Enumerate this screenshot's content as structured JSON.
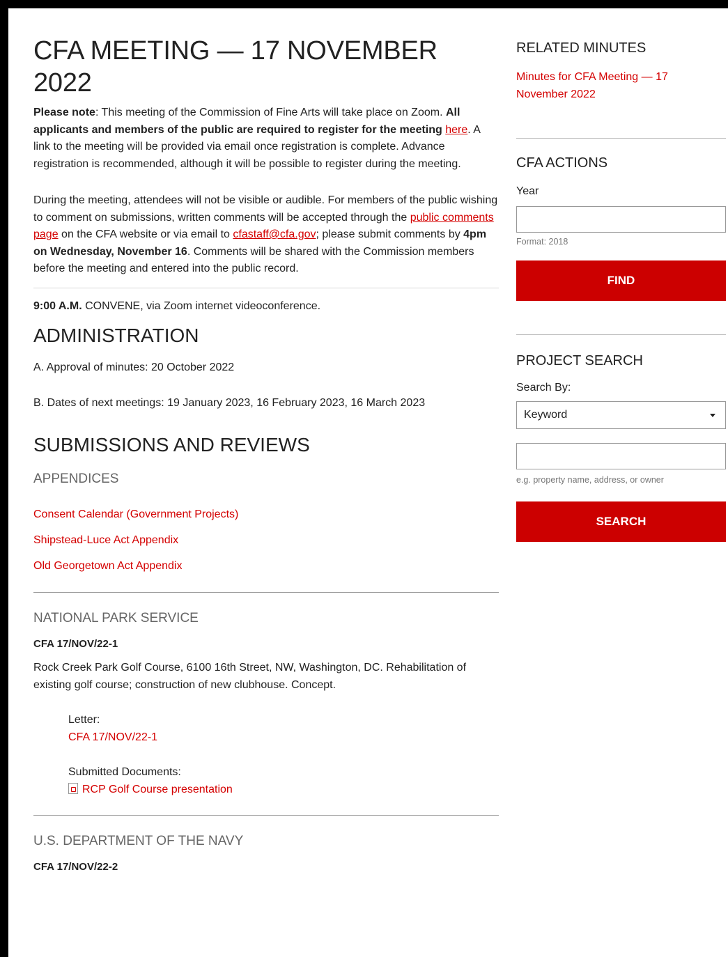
{
  "main": {
    "title": "CFA MEETING — 17 NOVEMBER 2022",
    "notice": {
      "please_note_label": "Please note",
      "text1": ": This meeting of the Commission of Fine Arts will take place on Zoom. ",
      "bold_required": "All applicants and members of the public are required to register for the meeting ",
      "here_link": "here",
      "text2": ". A link to the meeting will be provided via email once registration is complete. Advance registration is recommended, although it will be possible to register during the meeting."
    },
    "comments": {
      "text1": "During the meeting, attendees will not be visible or audible. For members of the public wishing to comment on submissions, written comments will be accepted through the ",
      "public_comments_link": "public comments page",
      "text2": " on the CFA website or via email to ",
      "email_link": "cfastaff@cfa.gov",
      "text3": "; please submit comments by ",
      "deadline_bold": "4pm on Wednesday, November 16",
      "text4": ". Comments will be shared with the Commission members before the meeting and entered into the public record."
    },
    "convene": {
      "time": "9:00 A.M.",
      "text": " CONVENE, via Zoom internet videoconference."
    },
    "administration": {
      "heading": "ADMINISTRATION",
      "item_a": "A. Approval of minutes: 20 October 2022",
      "item_b": "B. Dates of next meetings: 19 January 2023, 16 February 2023, 16 March 2023"
    },
    "submissions": {
      "heading": "SUBMISSIONS AND REVIEWS",
      "appendices_heading": "APPENDICES",
      "appendices": [
        "Consent Calendar (Government Projects)",
        "Shipstead-Luce Act Appendix",
        "Old Georgetown Act Appendix"
      ]
    },
    "nps": {
      "heading": "NATIONAL PARK SERVICE",
      "case": "CFA 17/NOV/22-1",
      "description": "Rock Creek Park Golf Course, 6100 16th Street, NW, Washington, DC. Rehabilitation of existing golf course; construction of new clubhouse. Concept.",
      "letter_label": "Letter:",
      "letter_link": "CFA 17/NOV/22-1",
      "docs_label": "Submitted Documents:",
      "doc_link": "RCP Golf Course presentation"
    },
    "navy": {
      "heading": "U.S. DEPARTMENT OF THE NAVY",
      "case": "CFA 17/NOV/22-2"
    }
  },
  "sidebar": {
    "related_heading": "RELATED MINUTES",
    "related_link": "Minutes for CFA Meeting — 17 November 2022",
    "actions_heading": "CFA ACTIONS",
    "year_label": "Year",
    "year_value": "",
    "year_hint": "Format: 2018",
    "find_button": "FIND",
    "search_heading": "PROJECT SEARCH",
    "search_by_label": "Search By:",
    "search_by_selected": "Keyword",
    "keyword_value": "",
    "keyword_hint": "e.g. property name, address, or owner",
    "search_button": "SEARCH"
  },
  "colors": {
    "accent": "#cc0000",
    "link": "#d40000"
  }
}
